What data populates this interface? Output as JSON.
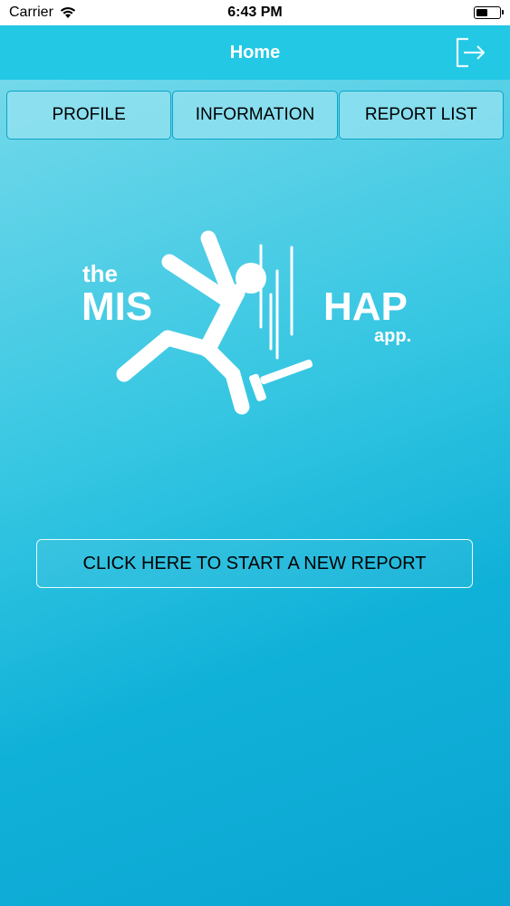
{
  "status_bar": {
    "carrier": "Carrier",
    "time": "6:43 PM",
    "wifi_icon": "wifi-icon",
    "battery_icon": "battery-icon"
  },
  "navbar": {
    "title": "Home",
    "logout_icon": "logout-icon"
  },
  "tabs": [
    {
      "label": "PROFILE"
    },
    {
      "label": "INFORMATION"
    },
    {
      "label": "REPORT LIST"
    }
  ],
  "logo": {
    "word_the": "the",
    "word_mis": "MIS",
    "word_hap": "HAP",
    "word_app": "app."
  },
  "main": {
    "start_report_label": "CLICK HERE TO START A NEW REPORT"
  },
  "colors": {
    "navbar": "#22c8e4",
    "background_top": "#7fdcec",
    "background_bottom": "#0aa5d2",
    "tab_border": "#0ea3c6"
  }
}
